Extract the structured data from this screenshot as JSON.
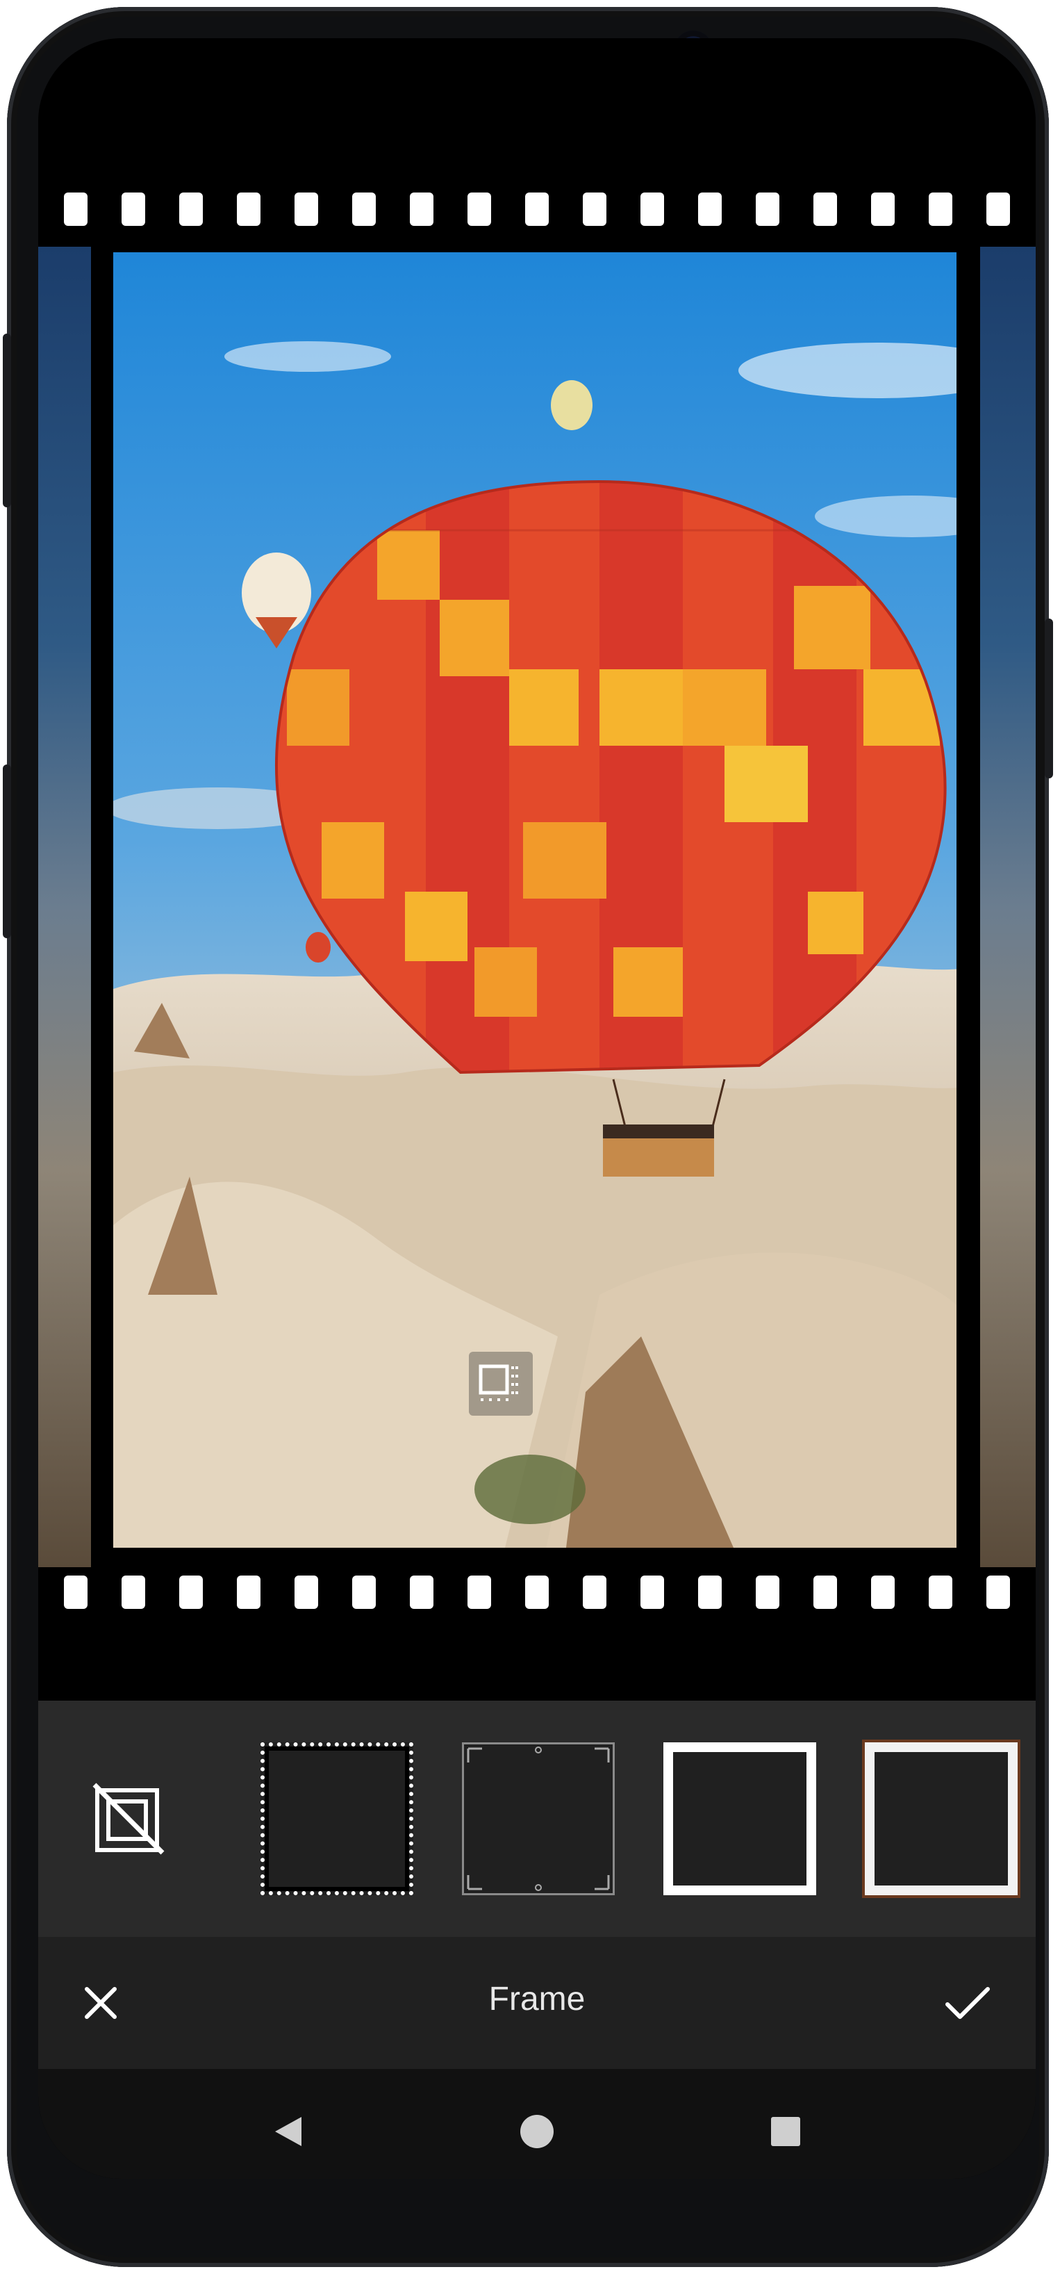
{
  "editor": {
    "title": "Frame",
    "cancel_icon": "close-icon",
    "confirm_icon": "checkmark-icon"
  },
  "frames": [
    {
      "id": "none",
      "icon": "no-frame-icon"
    },
    {
      "id": "film"
    },
    {
      "id": "ornate"
    },
    {
      "id": "white"
    },
    {
      "id": "wood"
    }
  ],
  "navigation": {
    "back_icon": "back-triangle-icon",
    "home_icon": "home-circle-icon",
    "recents_icon": "recents-square-icon"
  },
  "colors": {
    "accent": "#ffffff",
    "toolbar": "#202020",
    "frames_panel": "#2a2a2a"
  }
}
